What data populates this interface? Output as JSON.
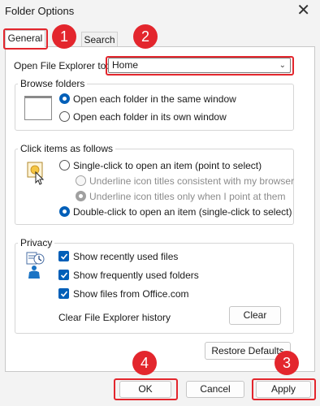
{
  "window": {
    "title": "Folder Options"
  },
  "tabs": [
    {
      "label": "General"
    },
    {
      "label": "Search"
    }
  ],
  "open_explorer": {
    "label": "Open File Explorer to:",
    "value": "Home"
  },
  "browse_folders": {
    "title": "Browse folders",
    "options": [
      {
        "label": "Open each folder in the same window",
        "checked": true
      },
      {
        "label": "Open each folder in its own window",
        "checked": false
      }
    ]
  },
  "click_items": {
    "title": "Click items as follows",
    "options": [
      {
        "label": "Single-click to open an item (point to select)",
        "checked": false
      },
      {
        "label": "Underline icon titles consistent with my browser",
        "checked": false,
        "disabled": true
      },
      {
        "label": "Underline icon titles only when I point at them",
        "checked": true,
        "disabled": true
      },
      {
        "label": "Double-click to open an item (single-click to select)",
        "checked": true
      }
    ]
  },
  "privacy": {
    "title": "Privacy",
    "checks": [
      {
        "label": "Show recently used files",
        "checked": true
      },
      {
        "label": "Show frequently used folders",
        "checked": true
      },
      {
        "label": "Show files from Office.com",
        "checked": true
      }
    ],
    "clear_label": "Clear File Explorer history",
    "clear_button": "Clear"
  },
  "buttons": {
    "restore": "Restore Defaults",
    "ok": "OK",
    "cancel": "Cancel",
    "apply": "Apply"
  },
  "annotations": {
    "badge_1": "1",
    "badge_2": "2",
    "badge_3": "3",
    "badge_4": "4"
  },
  "colors": {
    "accent": "#005fb8",
    "highlight": "#e3262d"
  }
}
